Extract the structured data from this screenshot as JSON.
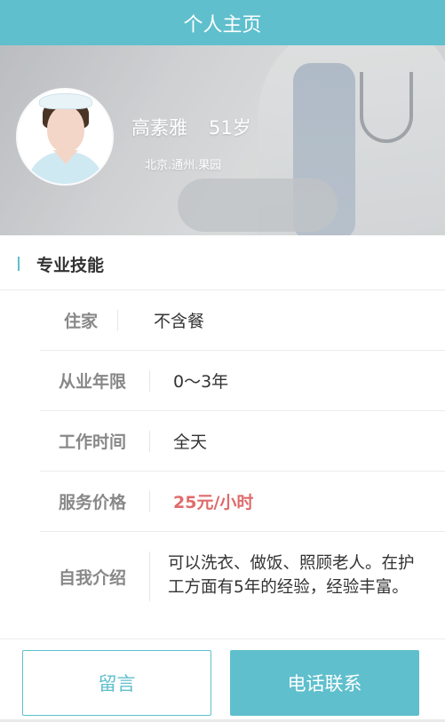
{
  "header": {
    "title": "个人主页"
  },
  "profile": {
    "name": "高素雅",
    "age": "51岁",
    "location": "北京.通州.果园"
  },
  "section": {
    "title": "专业技能"
  },
  "details": [
    {
      "label": "住家",
      "value": "不含餐"
    },
    {
      "label": "从业年限",
      "value": "0～3年"
    },
    {
      "label": "工作时间",
      "value": "全天"
    },
    {
      "label": "服务价格",
      "value": "25元/小时"
    },
    {
      "label": "自我介绍",
      "value": "可以洗衣、做饭、照顾老人。在护工方面有5年的经验，经验丰富。"
    }
  ],
  "actions": {
    "message_label": "留言",
    "call_label": "电话联系"
  },
  "colors": {
    "accent": "#5fbfcd",
    "price": "#e06b6b",
    "label": "#888888"
  }
}
